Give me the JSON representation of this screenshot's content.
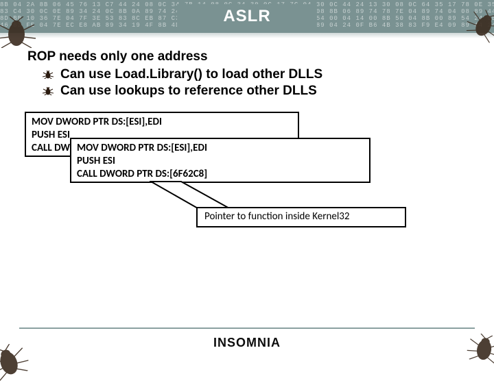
{
  "header": {
    "title": "ASLR"
  },
  "main": {
    "heading": "ROP needs only one address",
    "bullets": [
      "Can use Load.Library() to load other DLLS",
      "Can use lookups to reference other DLLS"
    ]
  },
  "code_box_1": {
    "lines": [
      "MOV DWORD PTR DS:[ESI],EDI",
      "PUSH ESI",
      "CALL DWO"
    ]
  },
  "code_box_2": {
    "lines": [
      "MOV DWORD PTR DS:[ESI],EDI",
      "PUSH ESI",
      "CALL DWORD PTR DS:[6F62C8]"
    ]
  },
  "callout": {
    "text": "Pointer to function inside Kernel32"
  },
  "footer": {
    "brand": "INSOMNIA"
  }
}
